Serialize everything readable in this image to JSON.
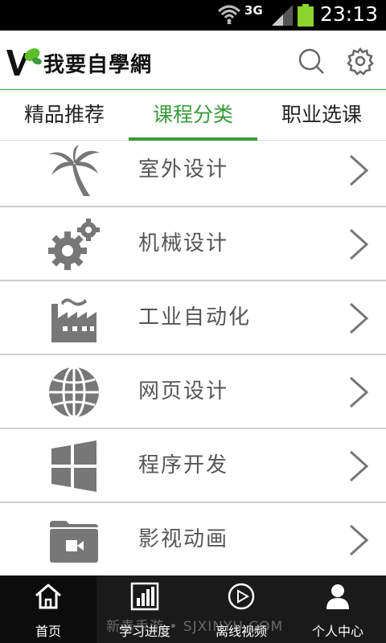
{
  "status_bar": {
    "network": "3G",
    "time": "23:13",
    "icons": [
      "wifi-icon",
      "signal-icon",
      "battery-icon"
    ]
  },
  "header": {
    "app_name": "我要自學網",
    "logo_icon": "v-leaf-logo-icon",
    "search_icon": "search-icon",
    "settings_icon": "gear-icon"
  },
  "tabs": [
    {
      "label": "精品推荐",
      "active": false
    },
    {
      "label": "课程分类",
      "active": true
    },
    {
      "label": "职业选课",
      "active": false
    }
  ],
  "categories": [
    {
      "label": "室外设计",
      "icon": "palm-tree-icon"
    },
    {
      "label": "机械设计",
      "icon": "gears-icon"
    },
    {
      "label": "工业自动化",
      "icon": "factory-icon"
    },
    {
      "label": "网页设计",
      "icon": "globe-icon"
    },
    {
      "label": "程序开发",
      "icon": "windows-icon"
    },
    {
      "label": "影视动画",
      "icon": "video-folder-icon"
    }
  ],
  "bottom_nav": [
    {
      "label": "首页",
      "icon": "home-icon",
      "active": true
    },
    {
      "label": "学习进度",
      "icon": "bar-chart-icon",
      "active": false
    },
    {
      "label": "离线视频",
      "icon": "play-circle-icon",
      "active": false
    },
    {
      "label": "个人中心",
      "icon": "user-icon",
      "active": false
    }
  ],
  "watermark": "新毒手游 • SJXINYU.COM",
  "colors": {
    "accent": "#3a9b3a",
    "icon_gray": "#777777",
    "nav_bg": "#1a1a1a",
    "battery": "#8cd32b"
  }
}
